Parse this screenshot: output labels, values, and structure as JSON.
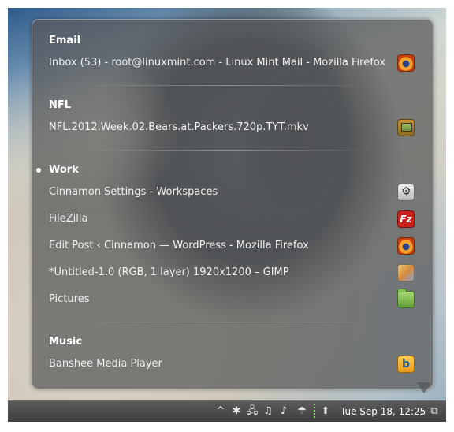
{
  "window_switcher": {
    "sections": [
      {
        "title": "Email",
        "active": false,
        "items": [
          {
            "label": "Inbox (53) - root@linuxmint.com - Linux Mint Mail - Mozilla Firefox",
            "icon": "firefox-icon"
          }
        ]
      },
      {
        "title": "NFL",
        "active": false,
        "items": [
          {
            "label": "NFL.2012.Week.02.Bears.at.Packers.720p.TYT.mkv",
            "icon": "media-player-icon"
          }
        ]
      },
      {
        "title": "Work",
        "active": true,
        "items": [
          {
            "label": "Cinnamon Settings - Workspaces",
            "icon": "settings-icon"
          },
          {
            "label": "FileZilla",
            "icon": "filezilla-icon",
            "icon_text": "Fz"
          },
          {
            "label": "Edit Post ‹ Cinnamon — WordPress - Mozilla Firefox",
            "icon": "firefox-icon"
          },
          {
            "label": "*Untitled-1.0 (RGB, 1 layer) 1920x1200 – GIMP",
            "icon": "gimp-icon"
          },
          {
            "label": "Pictures",
            "icon": "folder-icon"
          }
        ]
      },
      {
        "title": "Music",
        "active": false,
        "items": [
          {
            "label": "Banshee Media Player",
            "icon": "banshee-icon",
            "icon_text": "b"
          }
        ]
      }
    ]
  },
  "panel": {
    "tray_icons": [
      "chevron-up-icon",
      "bluetooth-icon",
      "network-icon",
      "music-note-icon",
      "volume-icon",
      "updates-icon",
      "upload-icon"
    ],
    "tray_glyphs": {
      "chevron": "^",
      "bluetooth": "✱",
      "network": "🖧",
      "music": "♫",
      "volume": "♪",
      "updates": "☂",
      "upload": "⬆",
      "windows": "⧉"
    },
    "clock": "Tue Sep 18, 12:25"
  },
  "colors": {
    "popup_bg": "#585858",
    "panel_bg": "#4a4a4a",
    "text": "#ffffff"
  }
}
